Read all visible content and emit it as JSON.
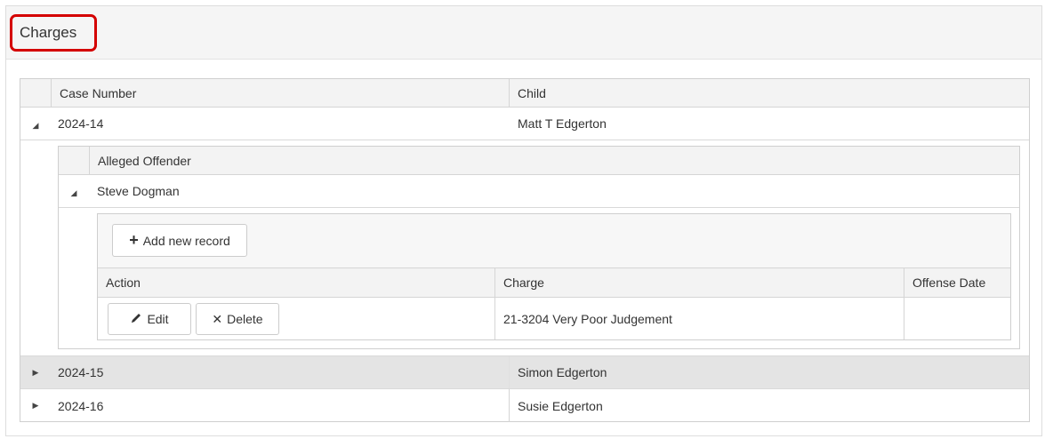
{
  "panel": {
    "title": "Charges"
  },
  "outer_grid": {
    "columns": [
      "Case Number",
      "Child"
    ],
    "rows": [
      {
        "case_number": "2024-14",
        "child": "Matt T Edgerton",
        "expanded": true
      },
      {
        "case_number": "2024-15",
        "child": "Simon Edgerton",
        "expanded": false
      },
      {
        "case_number": "2024-16",
        "child": "Susie Edgerton",
        "expanded": false
      }
    ]
  },
  "offender_grid": {
    "columns": [
      "Alleged Offender"
    ],
    "rows": [
      {
        "offender": "Steve Dogman",
        "expanded": true
      }
    ]
  },
  "charges_grid": {
    "toolbar": {
      "add_label": "Add new record",
      "add_icon": "plus-icon"
    },
    "columns": [
      "Action",
      "Charge",
      "Offense Date"
    ],
    "rows": [
      {
        "edit_label": "Edit",
        "delete_label": "Delete",
        "charge": "21-3204 Very Poor Judgement",
        "offense_date": ""
      }
    ]
  },
  "icons": {
    "expanded": "triangle-down-icon",
    "collapsed": "triangle-right-icon",
    "edit": "pencil-icon",
    "delete": "x-icon"
  },
  "colors": {
    "highlight_border": "#d40000",
    "header_bg": "#f3f3f3",
    "selected_row_bg": "#e4e4e4"
  }
}
